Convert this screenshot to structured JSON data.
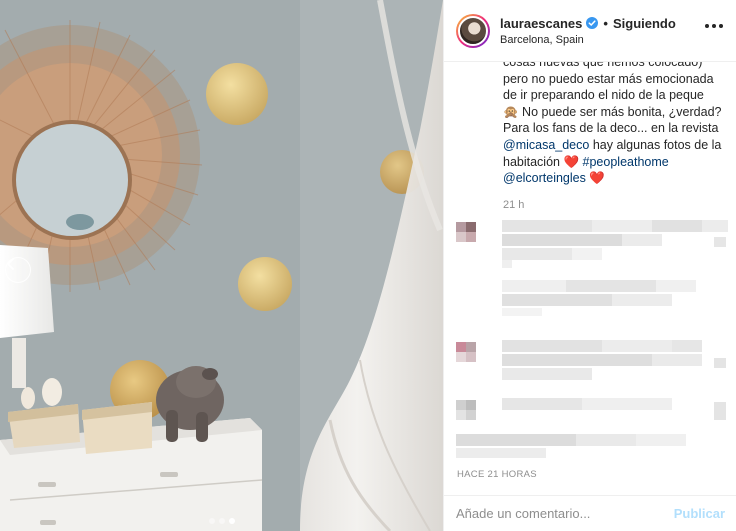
{
  "post": {
    "username": "lauraescanes",
    "follow_status": "Siguiendo",
    "separator": "•",
    "location": "Barcelona, Spain",
    "verified": true,
    "icons": [
      "verified-badge-icon",
      "more-options-icon",
      "carousel-prev-icon"
    ]
  },
  "caption": {
    "line1": "cosas nuevas que hemos colocado)",
    "line2": "pero no puedo estar más emocionada",
    "line3": "de ir preparando el nido de la peque",
    "line4_emoji": "🙊",
    "line4_text": " No puede ser más bonita, ¿verdad?",
    "line5": "Para los fans de la deco... en la revista",
    "mention1": "@micasa_deco",
    "line6_text": " hay algunas fotos de la",
    "line7_text": "habitación ",
    "heart": "❤️",
    "hashtag": "#peopleathome",
    "mention2": "@elcorteingles",
    "time": "21 h"
  },
  "footer": {
    "time_ago": "HACE 21 HORAS",
    "comment_placeholder": "Añade un comentario...",
    "publish_label": "Publicar"
  },
  "carousel": {
    "slides": 3,
    "active_index": 2
  },
  "colors": {
    "link": "#00376b",
    "verified": "#3897f0",
    "publish_disabled": "#b2dffc",
    "muted": "#8e8e8e"
  }
}
